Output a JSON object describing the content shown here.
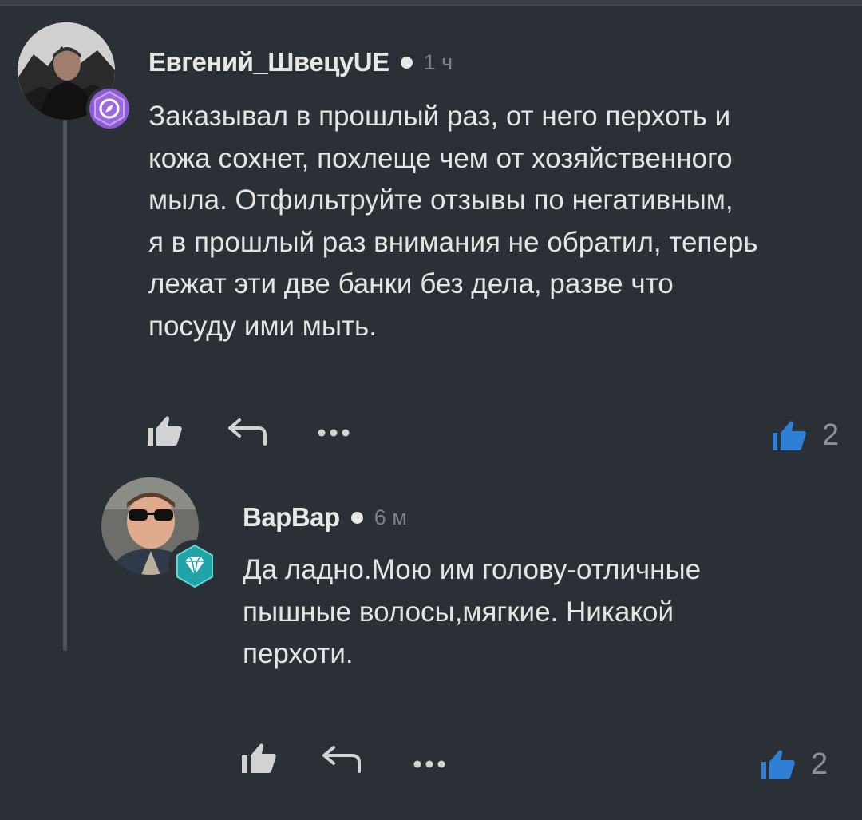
{
  "comments": [
    {
      "username": "Евгений_ШвецуUE",
      "time": "1 ч",
      "badge_icon": "compass-icon",
      "badge_color": "#8e5ad1",
      "lines": [
        "Заказывал в прошлый раз, от него перхоть и",
        "кожа сохнет, похлеще чем от хозяйственного",
        "мыла. Отфильтруйте отзывы по негативным,",
        "я в прошлый раз внимания не обратил, теперь",
        "лежат эти две банки без дела, разве что",
        "посуду ими мыть."
      ],
      "votes": "2"
    },
    {
      "username": "ВарВар",
      "time": "6 м",
      "badge_icon": "diamond-icon",
      "badge_color": "#1fa3a6",
      "lines": [
        "Да ладно.Мою им голову-отличные",
        "пышные волосы,мягкие. Никакой",
        "перхоти."
      ],
      "votes": "2"
    }
  ],
  "colors": {
    "background": "#2b3036",
    "vote_thumb": "#2f7fd6"
  }
}
